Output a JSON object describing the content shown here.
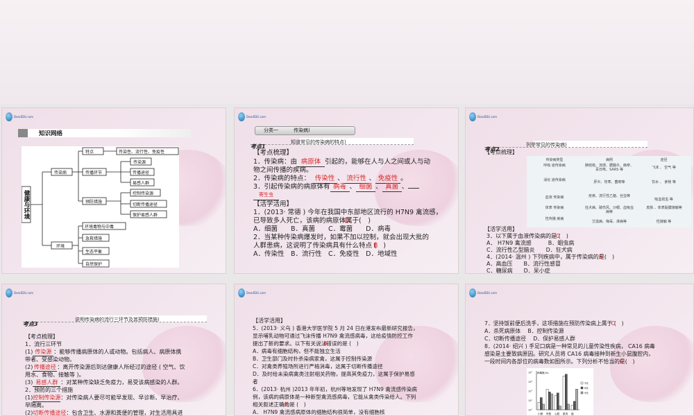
{
  "logo_text": "DearEDU.com",
  "slide1": {
    "section_title": "知识网络",
    "root": "健康与环境",
    "l1": [
      "传染病",
      "环境"
    ],
    "l2": [
      "特点",
      "传播环节",
      "预防措施",
      "环境毒物与中毒",
      "急救措施",
      "生态平衡",
      "自然保护"
    ],
    "l3": [
      "传染性、流行性、免疫性",
      "传染源",
      "传播途径",
      "易感人群",
      "控制传染源",
      "切断传播途径",
      "保护易感人群"
    ]
  },
  "slide2": {
    "category": "分类一",
    "category_title": "传染病)",
    "kaodian": "考点1",
    "kaodian_title": "知道常见的传染病的特点)",
    "h1": "【考点梳理】",
    "l1a": "1．传染病：由",
    "l1_blank": "病原体",
    "l1b": "引起的，能够在人与人之间或人与动",
    "l1c": "物之间传播的疾病。",
    "l2a": "2．传染病的特点：",
    "l2_b1": "传染性",
    "l2_b2": "流行性",
    "l2_b3": "免疫性",
    "l3a": "3．引起传染病的病原体有",
    "l3_b1": "病毒",
    "l3_b2": "细菌",
    "l3_b3": "真菌",
    "l3_b4": "寄生虫",
    "h2": "【活学活用】",
    "q1a": "1．(2013· 常德 ) 今年在我国中东部地区流行的 H7N9 禽流感，",
    "q1b": "已导致多人死亡，该病的病原体属于(　)",
    "q1_ans": "D",
    "q1_opts": "A．细菌　　B．真菌　　C．霉菌　　D．病毒",
    "q2a": "2．当某种传染病爆发时，如果不加以控制，就会出现大批的",
    "q2b": "人群患病，这说明了传染病具有什么特点 (　)",
    "q2_ans": "B",
    "q2_opts": "A．传染性　B．流行性　C．免疫性　D．地域性"
  },
  "slide3": {
    "kaodian": "考点2",
    "kaodian_title": "列举常见的传染病)",
    "h1": "【考点梳理】",
    "table": {
      "headers": [
        "传染病类型",
        "病例",
        "途径"
      ],
      "rows": [
        [
          "呼吸 道传染病",
          "肺结核、流感、腮腺炎、麻疹、百日咳、SARS 等",
          "飞沫 、 空气 等"
        ],
        [
          "消化 道传染病",
          "肝炎、伤寒、菌痢等",
          "饮水 、 食物 等"
        ],
        [
          "血液 传染病",
          "疟疾、流行性乙脑、丝虫等",
          "吸血昆虫 等"
        ],
        [
          "体表 传染病",
          "狂犬病、破伤风、沙眼、血吸虫病等",
          "皮肤 、体表黏膜接触等"
        ],
        [
          "性传播 疾病",
          "艾滋病、梅毒、淋病等",
          "性接触 等"
        ]
      ]
    },
    "h2": "【活学活用】",
    "q3": "3．以下属于血液传染病的是 (　)",
    "q3_ans": "C",
    "q3_o1": "A． H7N9 禽流感　　　B．蛔虫病",
    "q3_o2": "C．流行性乙型脑炎　　D．狂犬病",
    "q4": "4．(2014· 温州 ) 下列疾病中，属于传染病的是(　)",
    "q4_ans": "B",
    "q4_o1": "A．高血压　　B．流行性感冒",
    "q4_o2": "C．糖尿病　　D．呆小症"
  },
  "slide4": {
    "kaodian": "考点3",
    "kaodian_title": "说明传染病的流行三环节及其预防措施)",
    "h1": "【考点梳理】",
    "l1": "1．流行三环节",
    "i1_blank": "传染源",
    "i1": "：能够传播病原体的人或动物。包括病人、病原体携",
    "i1b": "带者、受感染动物。",
    "i2_blank": "传播途径",
    "i2": "：离开传染源后到达健康人所经过的途径 ( 空气、饮",
    "i2b": "用水、食物、接触等 )。",
    "i3_blank": "易感人群",
    "i3": "：对某种传染缺乏免疫力，易受该病感染的人群。",
    "l2": "2．预防的三个措施",
    "p1_blank": "控制传染源",
    "p1": "：对传染病人要尽可能早发现、早诊断、早治疗、",
    "p1b": "早隔离。",
    "p2_blank": "切断传播途径",
    "p2": "：包含卫生、水源和粪便的管理，对生活用具进"
  },
  "slide5": {
    "h": "【活学活用】",
    "q5a": "5．(2013· 义乌 ) 香港大学医学院 5 月 24 日在港发布最新研究报告，",
    "q5b": "显示哺乳动物可通过飞沫传播 H7N9 禽流感病毒，这给疫情防控工作",
    "q5c": "提出了新的要求。以下有关说法错误的是 (　)",
    "q5_ans": "A",
    "oA": "A．病毒有细胞结构，但不能独立生活",
    "oB": "B．卫生部门及时扑杀染病家禽，这属于控制传染源",
    "oC": "C．对禽类养殖场所进行严格消毒，这属于切断传播途径",
    "oD": "D．及时给未染病禽类注射相关药物，提高其免疫力，这属于保护易感",
    "oD2": "者",
    "q6a": "6．(2013· 杭州 )2013 年年初，杭州等地发现了 H7N9 禽流感传染病",
    "q6b": "例，该病的病原体是一种新型禽流感病毒，它能从禽类传染给人。下列",
    "q6c": "相关叙述正确的是 (　)",
    "q6_ans": "B",
    "q6A": "A． H7N9 禽流感病原体的细胞结构很简单，没有细胞核"
  },
  "slide6": {
    "q7": "7．坚持饭前便后洗手，这项措施在预防传染病上属于 (　)",
    "q7_ans": "C",
    "q7_o1": "A．杀死病原体　 B．控制传染源",
    "q7_o2": "C．切断传播途径　 D．保护易感人群",
    "q8a": "8．(2014· 绍兴 ) 手足口病是一种常见的儿童传染性疾病， CA16 病毒",
    "q8b": "感染是主要致病原因。研究人员将 CA16 病毒接种到新生小鼠腹腔内，",
    "q8c": "一段时间内各部位的病毒数如图所示。下列分析不恰当的是(　)",
    "q8_ans": "C"
  },
  "chart_data": {
    "type": "bar",
    "title": "病毒数/mL",
    "categories": [
      "小肠",
      "肝脏",
      "心脏",
      "肌肉",
      "脑"
    ],
    "ylabel": "病毒数/mL",
    "yscale": "log",
    "ylim": [
      1,
      5
    ],
    "ytick_labels": [
      "10¹",
      "10²",
      "10³",
      "10⁴",
      "10⁵"
    ],
    "legend": "right",
    "series": [
      {
        "name": "3天",
        "values": [
          1.8,
          3.2,
          2.5,
          4.6,
          1.5
        ],
        "color": "#ffffff"
      },
      {
        "name": "6天",
        "values": [
          2.3,
          2.9,
          2.8,
          4.8,
          1.9
        ],
        "color": "#555555"
      },
      {
        "name": "9天",
        "values": [
          1.6,
          2.7,
          1.4,
          1.6,
          3.2
        ],
        "color": "#aaaaaa"
      }
    ]
  }
}
